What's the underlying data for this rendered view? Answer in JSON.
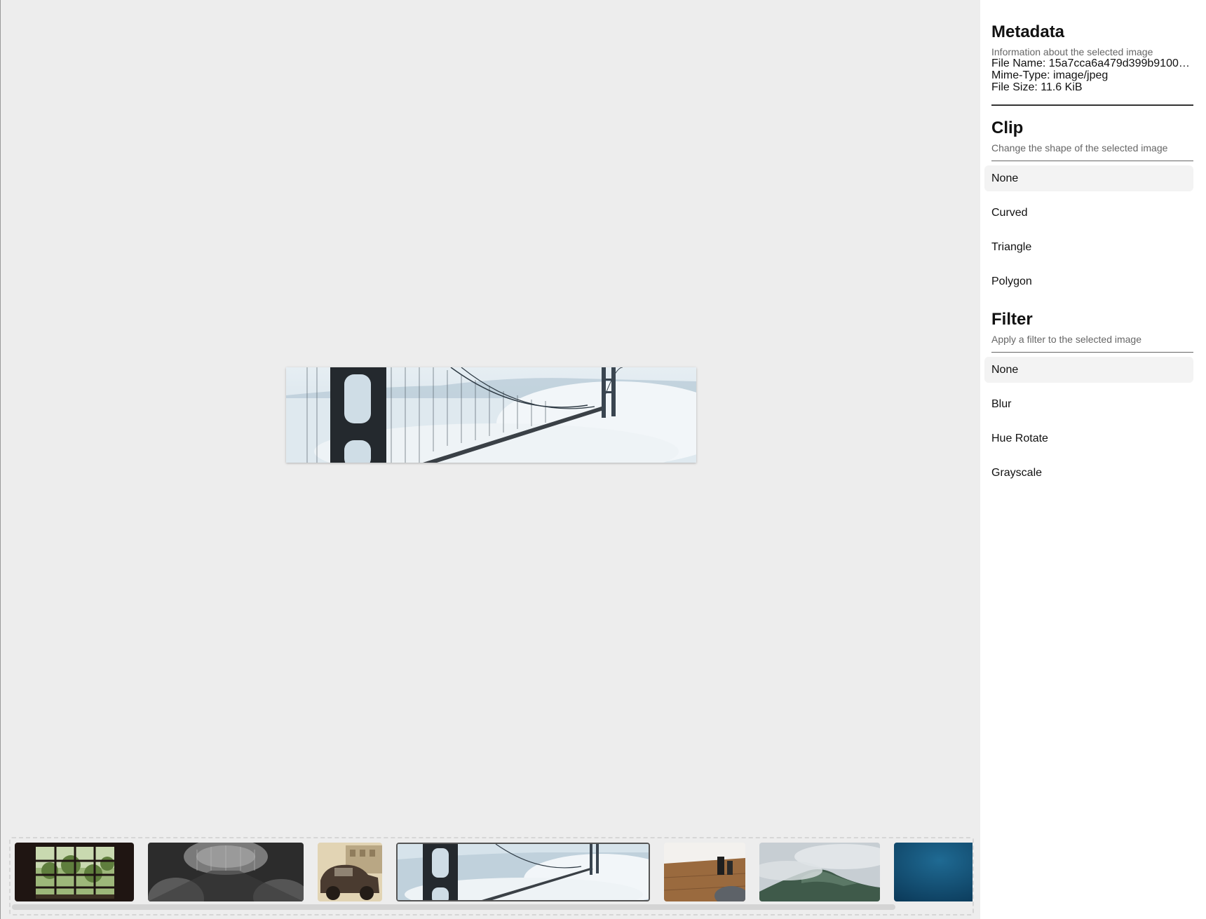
{
  "metadata": {
    "title": "Metadata",
    "description": "Information about the selected image",
    "file_name": "File Name: 15a7cca6a479d399b9100…",
    "mime_type": "Mime-Type: image/jpeg",
    "file_size": "File Size: 11.6 KiB"
  },
  "clip": {
    "title": "Clip",
    "description": "Change the shape of the selected image",
    "options": [
      "None",
      "Curved",
      "Triangle",
      "Polygon"
    ],
    "selected": "None"
  },
  "filter": {
    "title": "Filter",
    "description": "Apply a filter to the selected image",
    "options": [
      "None",
      "Blur",
      "Hue Rotate",
      "Grayscale"
    ],
    "selected": "None"
  },
  "thumbnails": [
    {
      "subject": "window with trees",
      "selected": false
    },
    {
      "subject": "classical columns",
      "selected": false
    },
    {
      "subject": "vintage car",
      "selected": false
    },
    {
      "subject": "suspension bridge in fog",
      "selected": true
    },
    {
      "subject": "desk with coffee",
      "selected": false
    },
    {
      "subject": "misty mountain",
      "selected": false
    },
    {
      "subject": "deep blue water",
      "selected": false
    }
  ],
  "colors": {
    "canvas_bg": "#ededed",
    "sidebar_bg": "#ffffff",
    "option_active_bg": "#f3f3f3",
    "muted_text": "#666666"
  }
}
